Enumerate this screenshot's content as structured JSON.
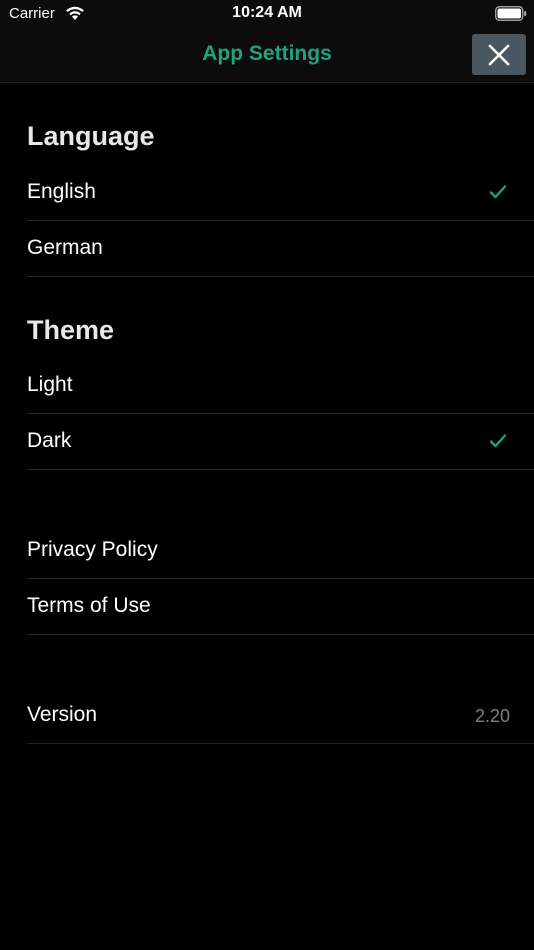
{
  "status_bar": {
    "carrier": "Carrier",
    "time": "10:24 AM",
    "wifi_icon": "wifi-icon",
    "battery_icon": "battery-full-icon"
  },
  "nav": {
    "title": "App Settings",
    "close_icon": "close-icon"
  },
  "colors": {
    "accent": "#1fa27e",
    "background": "#000000",
    "close_button": "#4a5660",
    "separator": "#232323",
    "secondary_text": "#808080"
  },
  "language": {
    "header": "Language",
    "options": [
      {
        "label": "English",
        "selected": true
      },
      {
        "label": "German",
        "selected": false
      }
    ]
  },
  "theme": {
    "header": "Theme",
    "options": [
      {
        "label": "Light",
        "selected": false
      },
      {
        "label": "Dark",
        "selected": true
      }
    ]
  },
  "legal": {
    "items": [
      {
        "label": "Privacy Policy"
      },
      {
        "label": "Terms of Use"
      }
    ]
  },
  "about": {
    "version_label": "Version",
    "version_value": "2.20"
  }
}
